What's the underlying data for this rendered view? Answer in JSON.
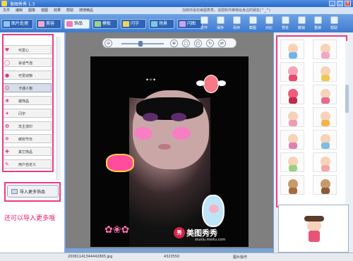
{
  "window": {
    "title": "美图秀秀 1.3",
    "slogan": "加菲你喜欢美图秀秀，请把软件推荐给身边的朋友(^_^)"
  },
  "menu": [
    "文件",
    "编辑",
    "图像",
    "视图",
    "效果",
    "帮助",
    "搜搜精品"
  ],
  "tabs": [
    {
      "label": "图片处理",
      "active": false
    },
    {
      "label": "美容",
      "active": false
    },
    {
      "label": "饰品",
      "active": true
    },
    {
      "label": "模板",
      "active": false
    },
    {
      "label": "闪字",
      "active": false
    },
    {
      "label": "场景",
      "active": false
    },
    {
      "label": "闪图",
      "active": false
    }
  ],
  "tools": [
    "打开",
    "保存",
    "另存",
    "截图",
    "对比",
    "预览",
    "撤销",
    "重做",
    "帮助"
  ],
  "categories": [
    {
      "label": "可爱心",
      "icon": "heart-icon"
    },
    {
      "label": "会话气泡",
      "icon": "bubble-icon"
    },
    {
      "label": "可爱动物",
      "icon": "animal-icon"
    },
    {
      "label": "卡通人物",
      "icon": "cartoon-icon",
      "active": true
    },
    {
      "label": "装饰品",
      "icon": "ornament-icon"
    },
    {
      "label": "闪字",
      "icon": "flash-text-icon"
    },
    {
      "label": "非主流印",
      "icon": "stamp-icon"
    },
    {
      "label": "缤纷节日",
      "icon": "festival-icon"
    },
    {
      "label": "其它饰品",
      "icon": "other-icon"
    },
    {
      "label": "用户自定义",
      "icon": "custom-icon"
    }
  ],
  "import_button": "导入更多饰品",
  "annotation": "还可以导入更多哦",
  "canvas": {
    "watermark": {
      "mark": "秀",
      "brand": "美图秀秀",
      "url": "xiuxiu.meitu.com"
    }
  },
  "status": {
    "filename": "20081141344442865.jpg",
    "number": "4323550",
    "mode": "图片操作"
  },
  "colors": {
    "accent": "#ec3b85",
    "titlebar": "#2b69c8"
  }
}
